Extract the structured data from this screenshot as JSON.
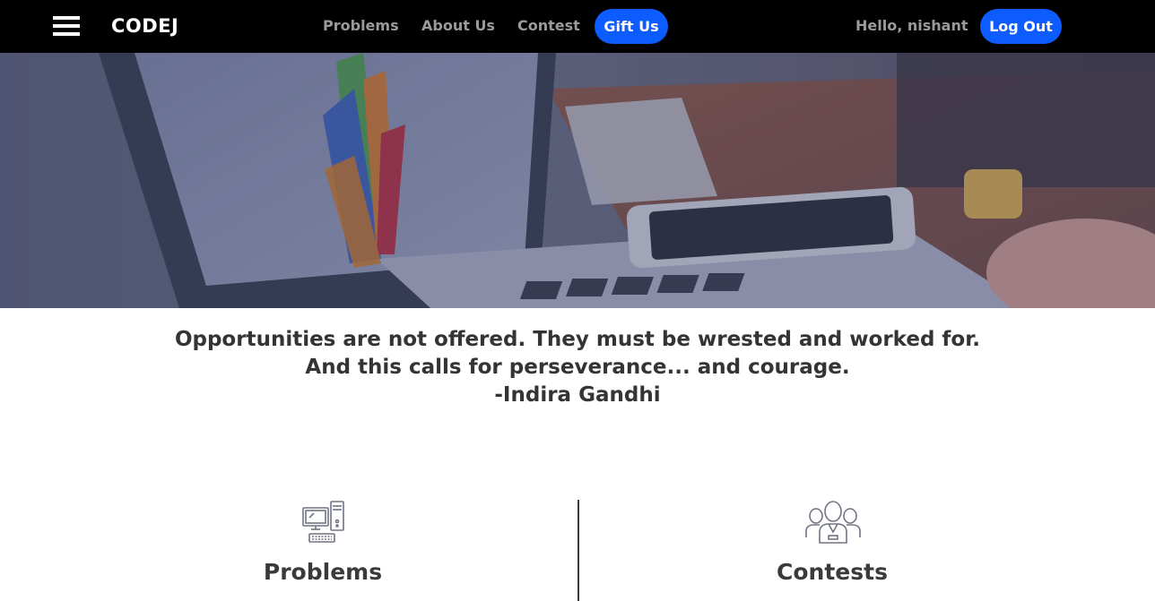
{
  "navbar": {
    "brand": "CODEJ",
    "links": {
      "problems": "Problems",
      "about": "About Us",
      "contest": "Contest"
    },
    "gift_label": "Gift Us",
    "greeting": "Hello, nishant",
    "logout_label": "Log Out"
  },
  "quote": {
    "line1": "Opportunities are not offered. They must be wrested and worked for.",
    "line2": "And this calls for perseverance... and courage.",
    "author": "-Indira Gandhi"
  },
  "features": {
    "problems": {
      "title": "Problems",
      "icon": "computer-icon"
    },
    "contests": {
      "title": "Contests",
      "icon": "people-group-icon"
    }
  },
  "colors": {
    "navbar_bg": "#000000",
    "accent": "#0d5cff",
    "nav_text": "#9b9b9b",
    "heading_text": "#343434"
  }
}
